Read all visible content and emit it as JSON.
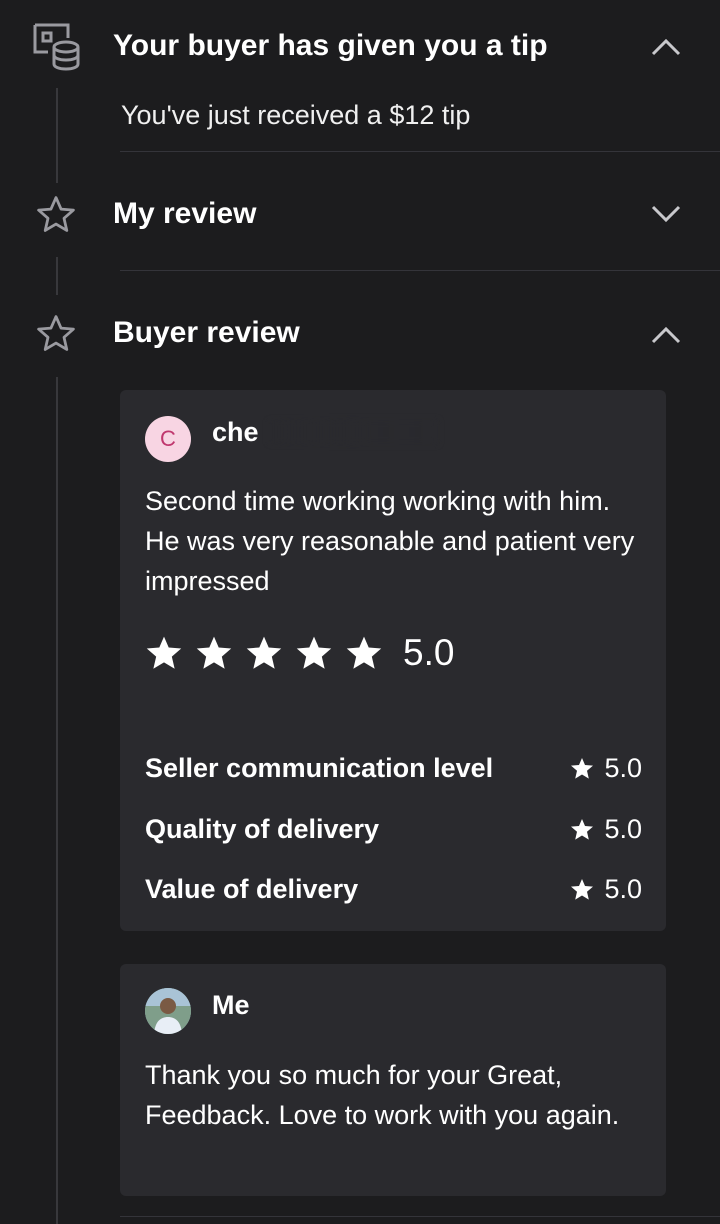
{
  "tip_section": {
    "title": "Your buyer has given you a tip",
    "message": "You've just received a $12 tip",
    "icon": "money-stack-icon",
    "expanded": true
  },
  "my_review_section": {
    "title": "My review",
    "icon": "star-outline-icon",
    "expanded": false
  },
  "buyer_review_section": {
    "title": "Buyer review",
    "icon": "star-outline-icon",
    "expanded": true,
    "review": {
      "avatar_letter": "C",
      "author": "che",
      "text": "Second time working working with him. He was very reasonable and patient very impressed",
      "rating": 5,
      "rating_display": "5.0",
      "criteria": [
        {
          "label": "Seller communication level",
          "value": "5.0"
        },
        {
          "label": "Quality of delivery",
          "value": "5.0"
        },
        {
          "label": "Value of delivery",
          "value": "5.0"
        }
      ]
    },
    "reply": {
      "author": "Me",
      "text": "Thank you so much for your Great, Feedback. Love to work with you again."
    }
  },
  "colors": {
    "background": "#1c1c1e",
    "card": "#2a2a2e",
    "avatar_bg": "#f8d5e3",
    "avatar_letter": "#c0376e",
    "icon_gray": "#9a9aa0"
  }
}
